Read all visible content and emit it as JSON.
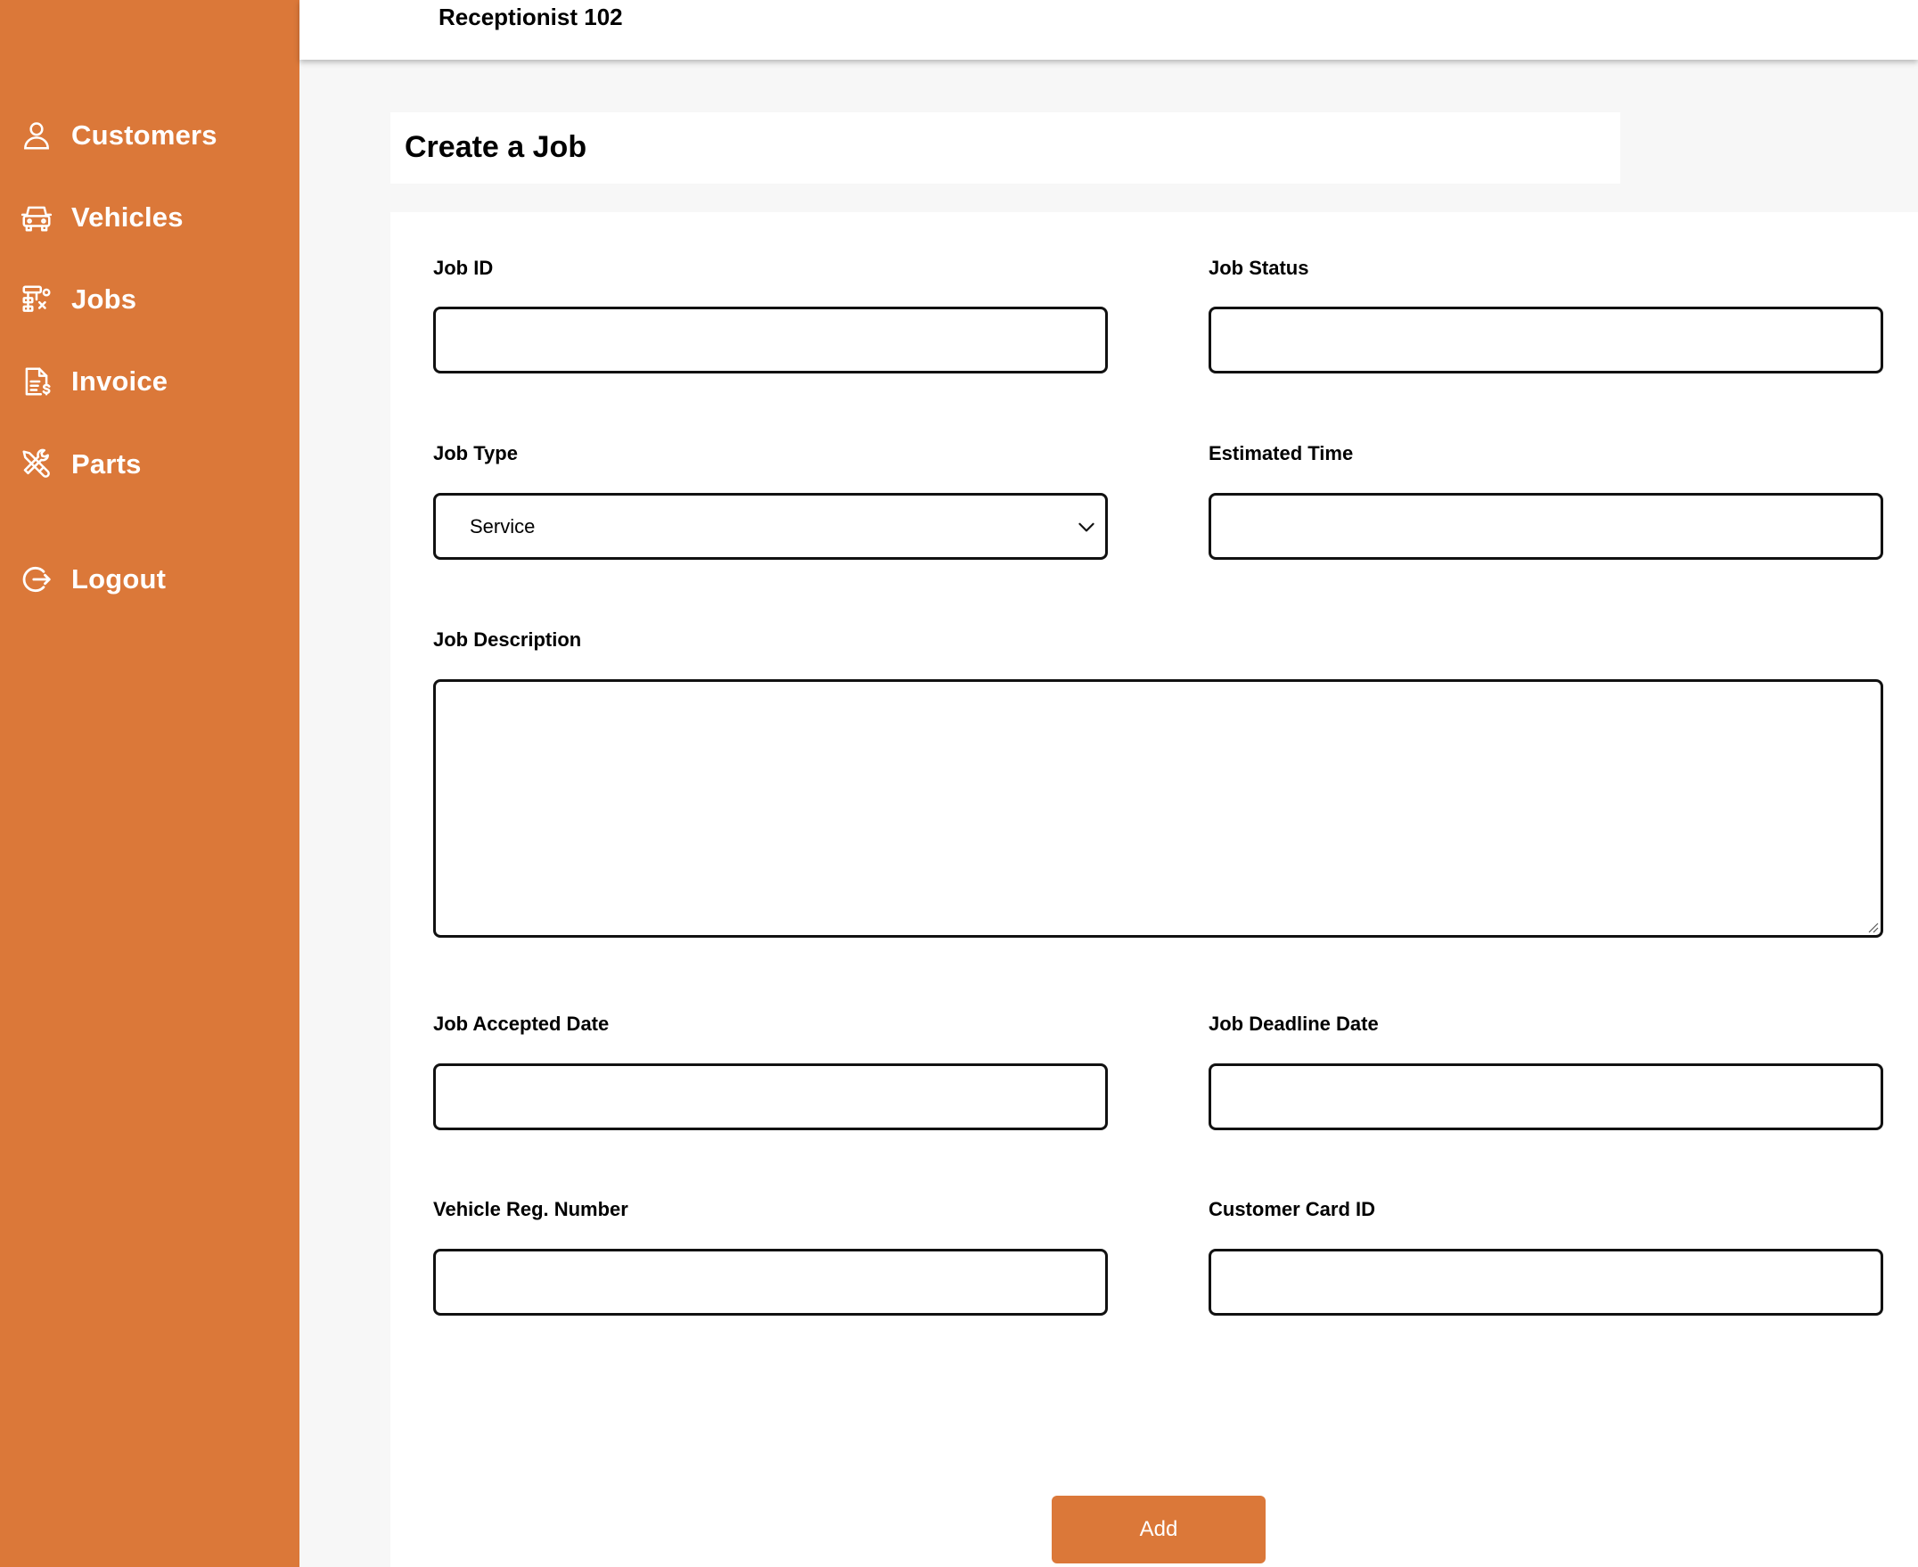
{
  "topbar": {
    "user_name": "Receptionist 102"
  },
  "sidebar": {
    "items": [
      {
        "label": "Customers",
        "icon": "user-icon"
      },
      {
        "label": "Vehicles",
        "icon": "car-icon"
      },
      {
        "label": "Jobs",
        "icon": "jobs-icon"
      },
      {
        "label": "Invoice",
        "icon": "invoice-icon"
      },
      {
        "label": "Parts",
        "icon": "tools-icon"
      }
    ],
    "logout": {
      "label": "Logout",
      "icon": "logout-icon"
    }
  },
  "page": {
    "title": "Create a Job"
  },
  "form": {
    "job_id": {
      "label": "Job ID",
      "value": ""
    },
    "job_status": {
      "label": "Job Status",
      "value": ""
    },
    "job_type": {
      "label": "Job Type",
      "value": "Service"
    },
    "estimated_time": {
      "label": "Estimated Time",
      "value": ""
    },
    "job_description": {
      "label": "Job Description",
      "value": ""
    },
    "job_accepted_date": {
      "label": "Job Accepted Date",
      "value": ""
    },
    "job_deadline_date": {
      "label": "Job Deadline Date",
      "value": ""
    },
    "vehicle_reg_number": {
      "label": "Vehicle Reg. Number",
      "value": ""
    },
    "customer_card_id": {
      "label": "Customer Card ID",
      "value": ""
    },
    "submit_label": "Add"
  },
  "colors": {
    "accent": "#db7839",
    "background": "#f7f7f7",
    "card": "#ffffff"
  }
}
